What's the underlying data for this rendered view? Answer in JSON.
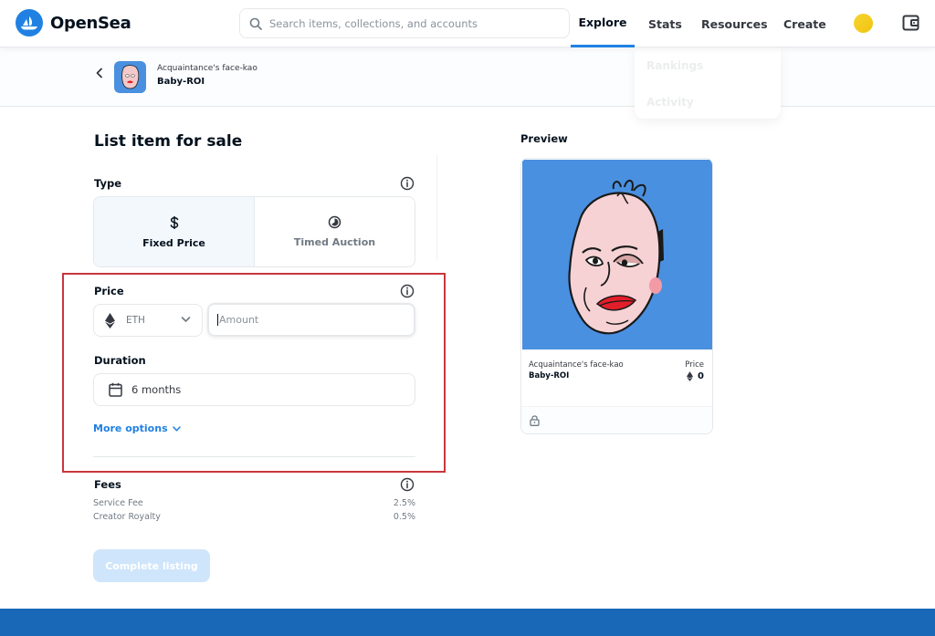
{
  "header": {
    "logo_text": "OpenSea",
    "search_placeholder": "Search items, collections, and accounts",
    "nav": {
      "explore": "Explore",
      "stats": "Stats",
      "resources": "Resources",
      "create": "Create"
    },
    "dropdown": [
      "Rankings",
      "Activity"
    ]
  },
  "breadcrumb": {
    "collection": "Acquaintance's face-kao",
    "item": "Baby-ROI"
  },
  "form": {
    "title": "List item for sale",
    "type_label": "Type",
    "type_options": [
      {
        "label": "Fixed Price",
        "icon": "dollar-icon",
        "selected": true
      },
      {
        "label": "Timed Auction",
        "icon": "clock-icon",
        "selected": false
      }
    ],
    "price_label": "Price",
    "currency": "ETH",
    "amount_placeholder": "Amount",
    "duration_label": "Duration",
    "duration_value": "6 months",
    "more_options": "More options",
    "fees_label": "Fees",
    "fees": [
      {
        "name": "Service Fee",
        "value": "2.5%"
      },
      {
        "name": "Creator Royalty",
        "value": "0.5%"
      }
    ],
    "submit": "Complete listing"
  },
  "preview": {
    "label": "Preview",
    "collection": "Acquaintance's face-kao",
    "name": "Baby-ROI",
    "price_label": "Price",
    "price": "0"
  },
  "colors": {
    "accent": "#2081e2",
    "highlight_border": "#c9363e",
    "image_bg": "#4a90e0",
    "footer": "#1868b7"
  }
}
